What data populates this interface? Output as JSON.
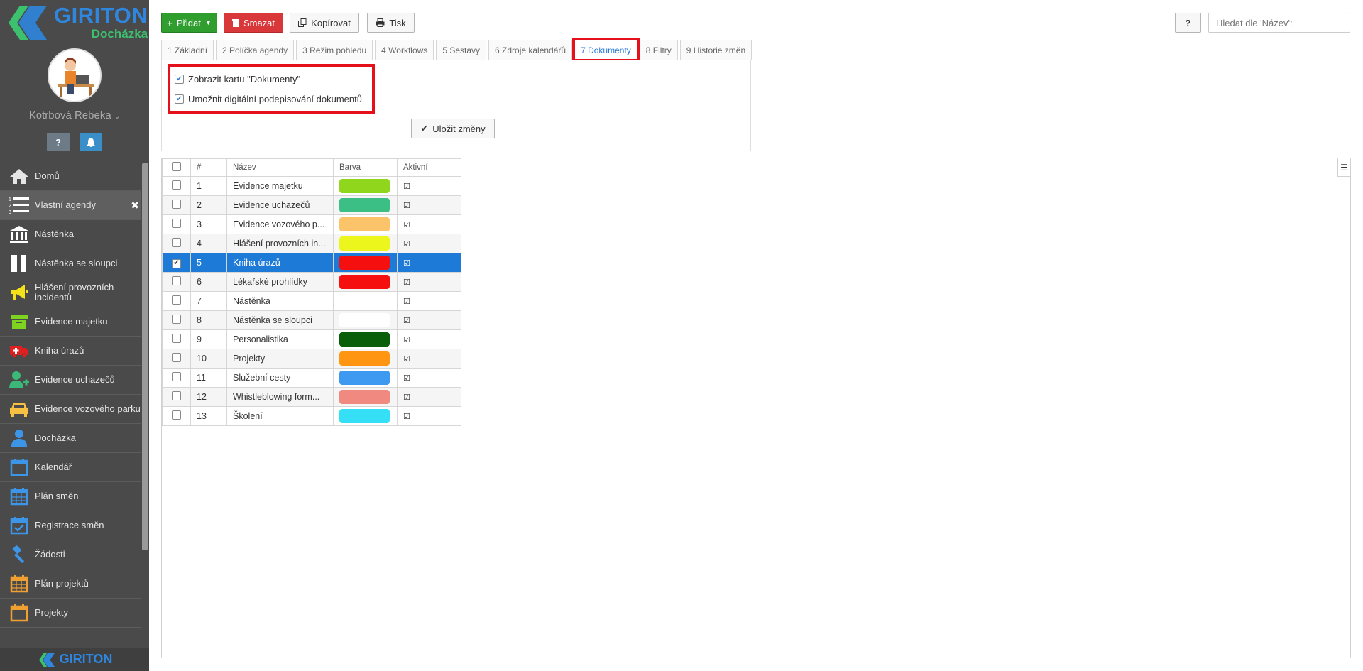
{
  "app": {
    "brand_name": "GIRITON",
    "brand_sub": "Docházka",
    "bottom_brand": "GIRITON"
  },
  "user": {
    "name": "Kotrbová Rebeka",
    "caret": "⌄"
  },
  "quick": {
    "help": "?",
    "bell": "🔔"
  },
  "nav": [
    {
      "label": "Domů",
      "icon": "home-icon",
      "color": "#e5e5e5"
    },
    {
      "label": "Vlastní agendy",
      "icon": "list-icon",
      "color": "#ffffff",
      "active": true,
      "close": "✖"
    },
    {
      "label": "Nástěnka",
      "icon": "bank-icon",
      "color": "#ffffff"
    },
    {
      "label": "Nástěnka se sloupci",
      "icon": "columns-icon",
      "color": "#ffffff"
    },
    {
      "label": "Hlášení provozních incidentů",
      "icon": "megaphone-icon",
      "color": "#f5e11a"
    },
    {
      "label": "Evidence majetku",
      "icon": "archive-icon",
      "color": "#7ed321"
    },
    {
      "label": "Kniha úrazů",
      "icon": "ambulance-icon",
      "color": "#e02020"
    },
    {
      "label": "Evidence uchazečů",
      "icon": "user-plus-icon",
      "color": "#3cb878"
    },
    {
      "label": "Evidence vozového parku",
      "icon": "car-icon",
      "color": "#f6c143"
    },
    {
      "label": "Docházka",
      "icon": "user-icon",
      "color": "#3d95e8"
    },
    {
      "label": "Kalendář",
      "icon": "calendar-icon",
      "color": "#3d95e8"
    },
    {
      "label": "Plán směn",
      "icon": "calendar-grid-icon",
      "color": "#3d95e8"
    },
    {
      "label": "Registrace směn",
      "icon": "calendar-check-icon",
      "color": "#3d95e8"
    },
    {
      "label": "Žádosti",
      "icon": "gavel-icon",
      "color": "#3d95e8"
    },
    {
      "label": "Plán projektů",
      "icon": "calendar-grid-icon",
      "color": "#f0a030"
    },
    {
      "label": "Projekty",
      "icon": "calendar-icon",
      "color": "#f0a030"
    }
  ],
  "toolbar": {
    "add": "Přidat",
    "delete": "Smazat",
    "copy": "Kopírovat",
    "print": "Tisk",
    "help": "?",
    "search_placeholder": "Hledat dle 'Název':"
  },
  "tabs": [
    {
      "label": "1 Základní"
    },
    {
      "label": "2 Políčka agendy"
    },
    {
      "label": "3 Režim pohledu"
    },
    {
      "label": "4 Workflows"
    },
    {
      "label": "5 Sestavy"
    },
    {
      "label": "6 Zdroje kalendářů"
    },
    {
      "label": "7 Dokumenty",
      "active": true
    },
    {
      "label": "8 Filtry"
    },
    {
      "label": "9 Historie změn"
    }
  ],
  "documents": {
    "show_tab_label": "Zobrazit kartu \"Dokumenty\"",
    "show_tab_checked": true,
    "digital_sign_label": "Umožnit digitální podepisování dokumentů",
    "digital_sign_checked": true,
    "save_label": "Uložit změny"
  },
  "grid": {
    "headers": {
      "num": "#",
      "name": "Název",
      "color": "Barva",
      "active": "Aktivní"
    },
    "rows": [
      {
        "num": "1",
        "name": "Evidence majetku",
        "color": "#8fd61c",
        "active": true,
        "checked": false
      },
      {
        "num": "2",
        "name": "Evidence uchazečů",
        "color": "#3cbf85",
        "active": true,
        "checked": false
      },
      {
        "num": "3",
        "name": "Evidence vozového p...",
        "color": "#fcc46a",
        "active": true,
        "checked": false
      },
      {
        "num": "4",
        "name": "Hlášení provozních in...",
        "color": "#ecf51c",
        "active": true,
        "checked": false
      },
      {
        "num": "5",
        "name": "Kniha úrazů",
        "color": "#f50f0f",
        "active": true,
        "checked": true,
        "selected": true
      },
      {
        "num": "6",
        "name": "Lékařské prohlídky",
        "color": "#f50f0f",
        "active": true,
        "checked": false
      },
      {
        "num": "7",
        "name": "Nástěnka",
        "color": "",
        "active": true,
        "checked": false
      },
      {
        "num": "8",
        "name": "Nástěnka se sloupci",
        "color": "#ffffff",
        "active": true,
        "checked": false
      },
      {
        "num": "9",
        "name": "Personalistika",
        "color": "#0a5e0a",
        "active": true,
        "checked": false
      },
      {
        "num": "10",
        "name": "Projekty",
        "color": "#ff9511",
        "active": true,
        "checked": false
      },
      {
        "num": "11",
        "name": "Služební cesty",
        "color": "#3d9af0",
        "active": true,
        "checked": false
      },
      {
        "num": "12",
        "name": "Whistleblowing form...",
        "color": "#f08a80",
        "active": true,
        "checked": false
      },
      {
        "num": "13",
        "name": "Školení",
        "color": "#35dff5",
        "active": true,
        "checked": false
      }
    ]
  },
  "colors": {
    "accent_blue": "#2a7ad6",
    "highlight_red": "#e5101a",
    "selected_row": "#1d7ad7"
  }
}
